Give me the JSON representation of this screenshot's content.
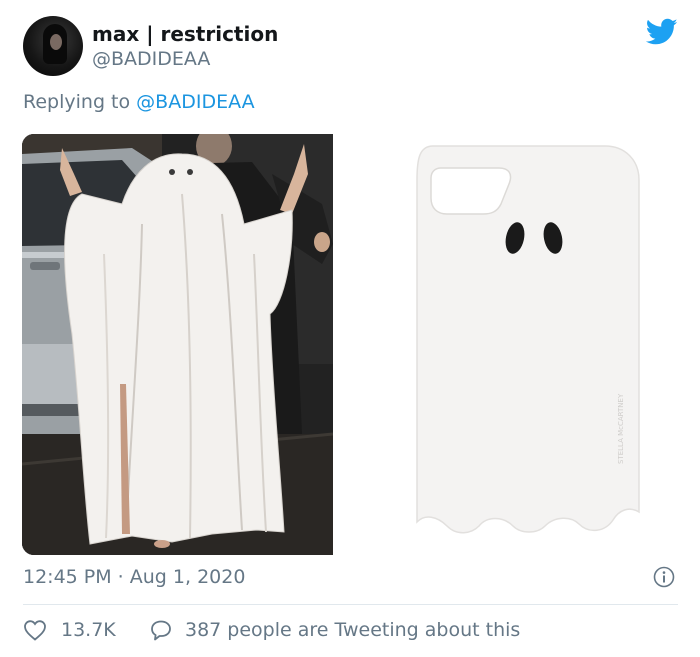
{
  "tweet": {
    "author": {
      "display_name": "max | restriction",
      "handle": "@BADIDEAA"
    },
    "reply_prefix": "Replying to",
    "reply_to": "@BADIDEAA",
    "timestamp": "12:45 PM · Aug 1, 2020",
    "likes": "13.7K",
    "conversation_text": "387 people are Tweeting about this",
    "brand_color": "#1da1f2",
    "case_brand_text": "STELLA McCARTNEY"
  }
}
